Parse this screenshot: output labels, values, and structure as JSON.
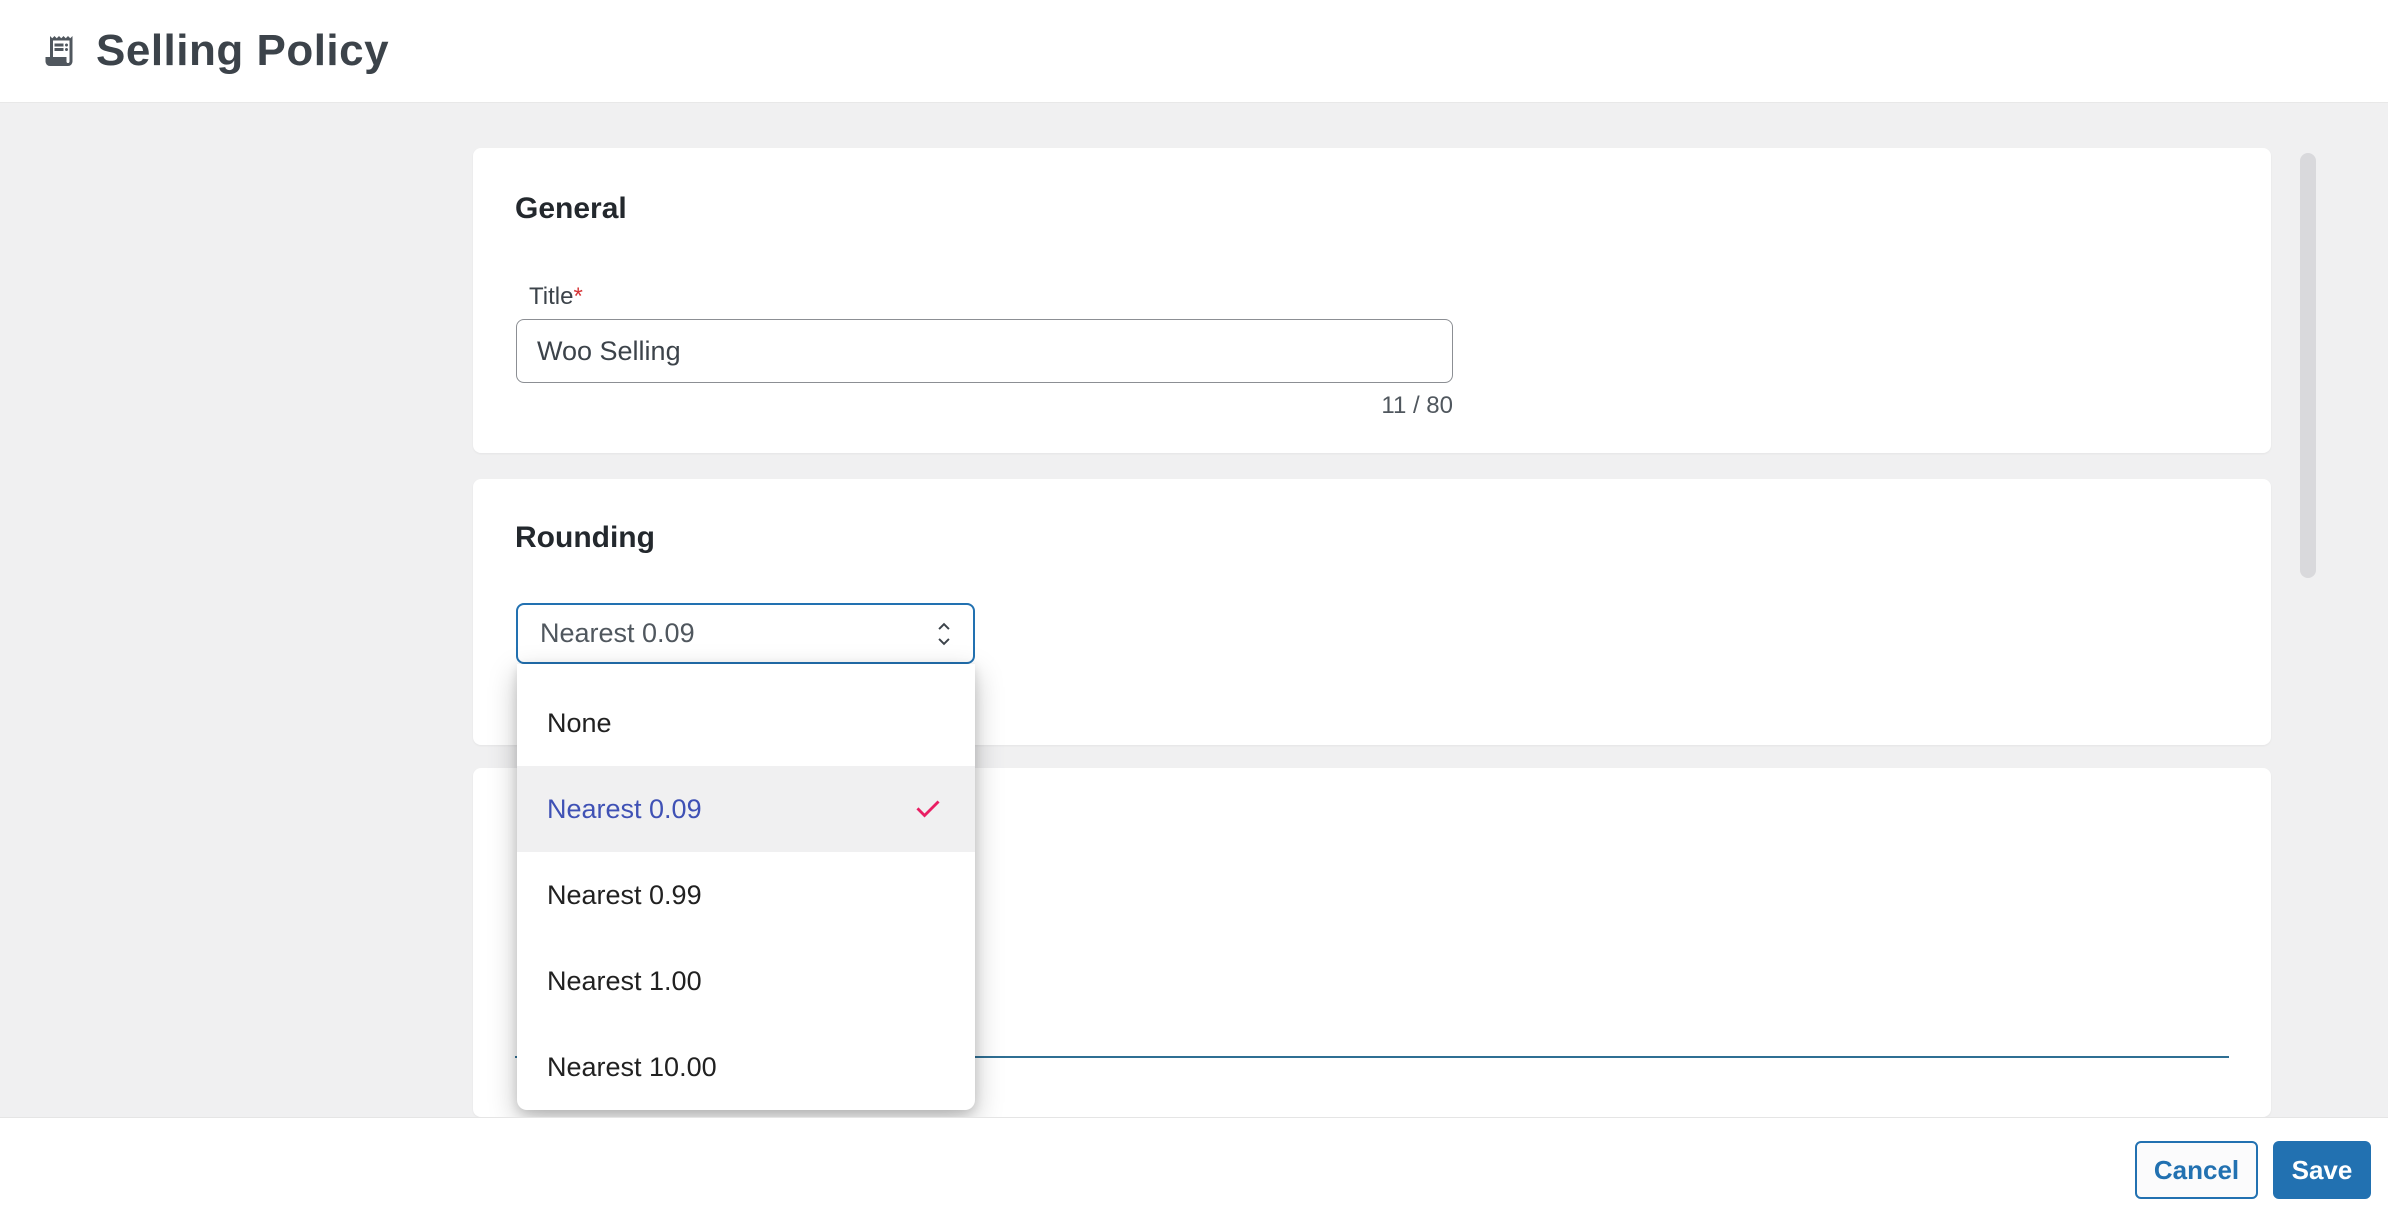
{
  "header": {
    "title": "Selling Policy"
  },
  "general_card": {
    "heading": "General",
    "title_label": "Title",
    "required_mark": "*",
    "title_value": "Woo Selling",
    "char_counter": "11 / 80"
  },
  "rounding_card": {
    "heading": "Rounding",
    "select_value": "Nearest 0.09"
  },
  "dropdown": {
    "options": [
      {
        "label": "None",
        "selected": false
      },
      {
        "label": "Nearest 0.09",
        "selected": true
      },
      {
        "label": "Nearest 0.99",
        "selected": false
      },
      {
        "label": "Nearest 1.00",
        "selected": false
      },
      {
        "label": "Nearest 10.00",
        "selected": false
      }
    ]
  },
  "footer": {
    "cancel_label": "Cancel",
    "save_label": "Save"
  },
  "icons": {
    "header": "receipt-long-icon",
    "select": "unfold-more-icon",
    "selected_option": "check-icon"
  },
  "colors": {
    "primary_blue": "#2271b1",
    "selected_option_text": "#3f51b5",
    "check_pink": "#e91e63",
    "required_red": "#d63638",
    "detail_underline": "#2f6f93",
    "page_background": "#f0f0f1"
  }
}
